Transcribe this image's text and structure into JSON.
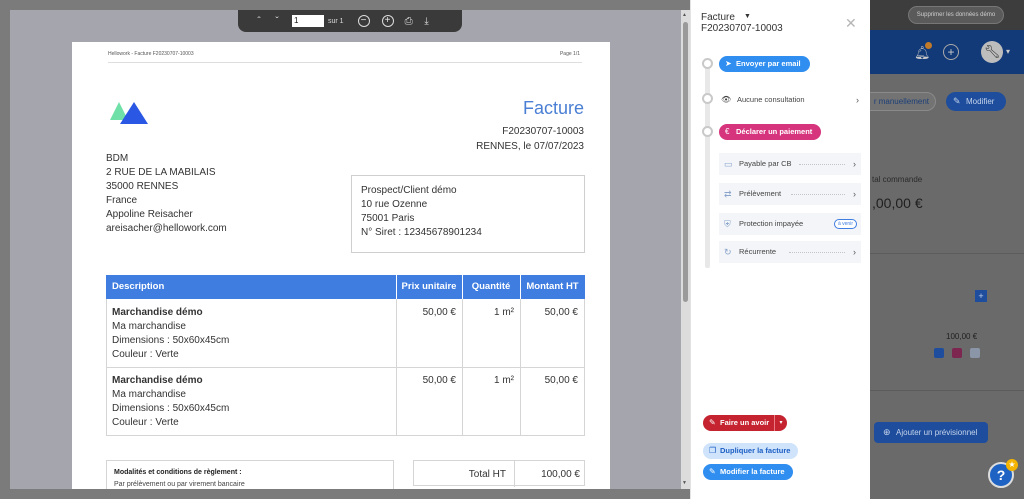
{
  "background_app": {
    "support_button": "Supprimer les données démo",
    "btn_manual": "r manuellement",
    "btn_modifier": "Modifier",
    "label_total": "tal commande",
    "value_total": ",00,00 €",
    "amount": "100,00 €",
    "btn_previsionnel": "Ajouter un prévisionnel",
    "help_label": "?"
  },
  "pdf_toolbar": {
    "prev_icon": "ˆ",
    "next_icon": "ˇ",
    "page_value": "1",
    "of_label": "sur 1",
    "zoom_out": "−",
    "zoom_in": "+",
    "print_icon": "⎙",
    "download_icon": "⤓"
  },
  "invoice": {
    "header_left": "Hellowork - Facture F20230707-10003",
    "header_right": "Page 1/1",
    "title": "Facture",
    "number": "F20230707-10003",
    "place_date": "RENNES, le 07/07/2023",
    "sender": [
      "BDM",
      "2 RUE DE LA MABILAIS",
      "35000 RENNES",
      "France",
      "Appoline Reisacher",
      "areisacher@hellowork.com"
    ],
    "client": [
      "Prospect/Client démo",
      "10 rue Ozenne",
      "75001 Paris",
      "N° Siret : 12345678901234"
    ],
    "columns": [
      "Description",
      "Prix unitaire",
      "Quantité",
      "Montant HT"
    ],
    "rows": [
      {
        "title": "Marchandise démo",
        "lines": [
          "Ma marchandise",
          "Dimensions : 50x60x45cm",
          "Couleur : Verte"
        ],
        "unit_price": "50,00 €",
        "quantity": "1 m²",
        "amount": "50,00 €"
      },
      {
        "title": "Marchandise démo",
        "lines": [
          "Ma marchandise",
          "Dimensions : 50x60x45cm",
          "Couleur : Verte"
        ],
        "unit_price": "50,00 €",
        "quantity": "1 m²",
        "amount": "50,00 €"
      }
    ],
    "modalites_title": "Modalités et conditions de règlement :",
    "modalites_text": "Par prélèvement ou par virement bancaire",
    "total_label": "Total HT",
    "total_value": "100,00 €"
  },
  "side_panel": {
    "doc_kind": "Facture",
    "doc_number": "F20230707-10003",
    "send_email": "Envoyer par email",
    "consultation": "Aucune consultation",
    "declare_payment": "Déclarer un paiement",
    "payment_options": [
      {
        "label": "Payable par CB",
        "icon": "card-icon"
      },
      {
        "label": "Prélèvement",
        "icon": "transfer-icon"
      },
      {
        "label": "Protection impayée",
        "icon": "shield-icon",
        "badge": "à venir"
      },
      {
        "label": "Récurrente",
        "icon": "recurring-icon"
      }
    ],
    "credit_note": "Faire un avoir",
    "duplicate": "Dupliquer la facture",
    "edit": "Modifier la facture"
  },
  "colors": {
    "accent_blue": "#3f7de0",
    "send_email_bg": "#2f8ef0",
    "declare_payment_bg": "#d6357d",
    "credit_note_bg": "#c4232f",
    "duplicate_bg": "#cfe3fb",
    "edit_bg": "#2f8ef0",
    "logo_green": "#6fe0a8",
    "logo_blue": "#2a58e4"
  }
}
